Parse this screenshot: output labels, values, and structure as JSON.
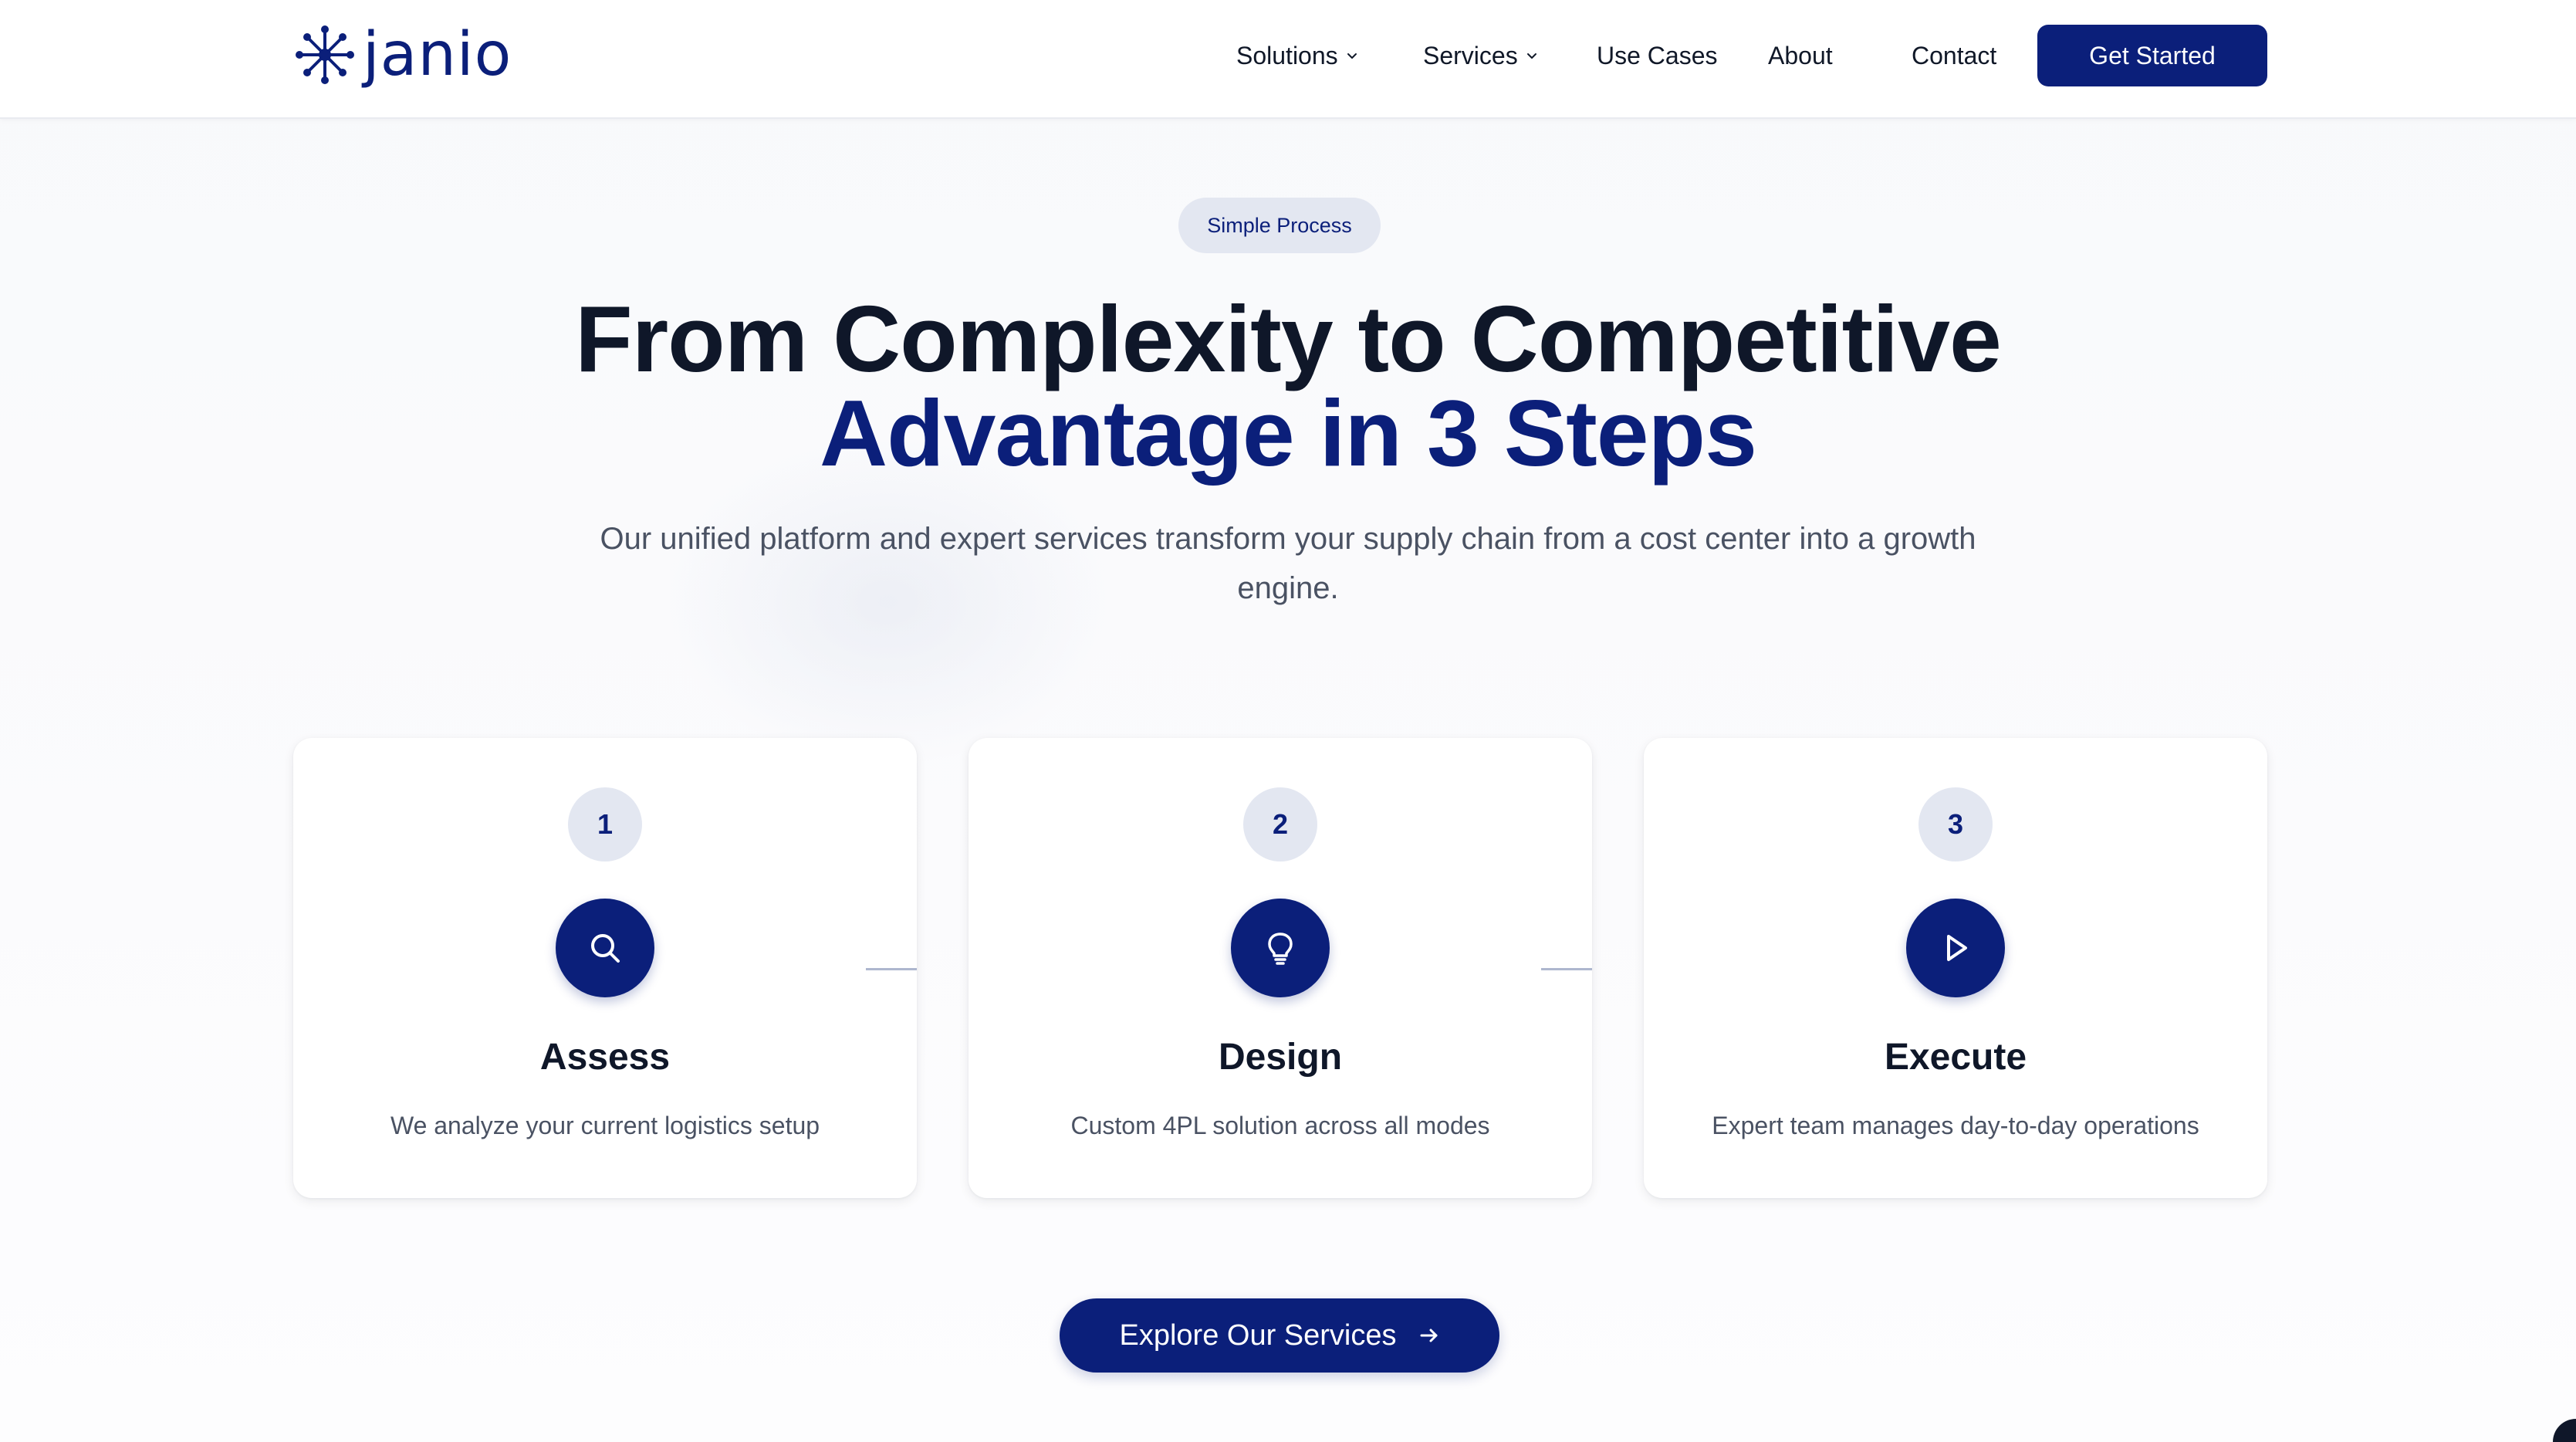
{
  "brand": {
    "name": "janio"
  },
  "nav": {
    "items": [
      {
        "label": "Solutions",
        "has_dropdown": true
      },
      {
        "label": "Services",
        "has_dropdown": true
      },
      {
        "label": "Use Cases",
        "has_dropdown": false
      },
      {
        "label": "About",
        "has_dropdown": false
      },
      {
        "label": "Contact",
        "has_dropdown": false
      }
    ],
    "cta_label": "Get Started"
  },
  "hero": {
    "badge": "Simple Process",
    "title_line1": "From Complexity to Competitive",
    "title_line2": "Advantage in 3 Steps",
    "subtitle": "Our unified platform and expert services transform your supply chain from a cost center into a growth engine."
  },
  "steps": [
    {
      "number": "1",
      "icon": "search-icon",
      "title": "Assess",
      "description": "We analyze your current logistics setup"
    },
    {
      "number": "2",
      "icon": "lightbulb-icon",
      "title": "Design",
      "description": "Custom 4PL solution across all modes"
    },
    {
      "number": "3",
      "icon": "play-icon",
      "title": "Execute",
      "description": "Expert team manages day-to-day operations"
    }
  ],
  "cta": {
    "label": "Explore Our Services",
    "icon": "arrow-right-icon"
  },
  "colors": {
    "brand": "#0b1f7a",
    "badge_bg": "#e3e7f1",
    "text_dark": "#0f1729",
    "text_muted": "#4a5263"
  }
}
